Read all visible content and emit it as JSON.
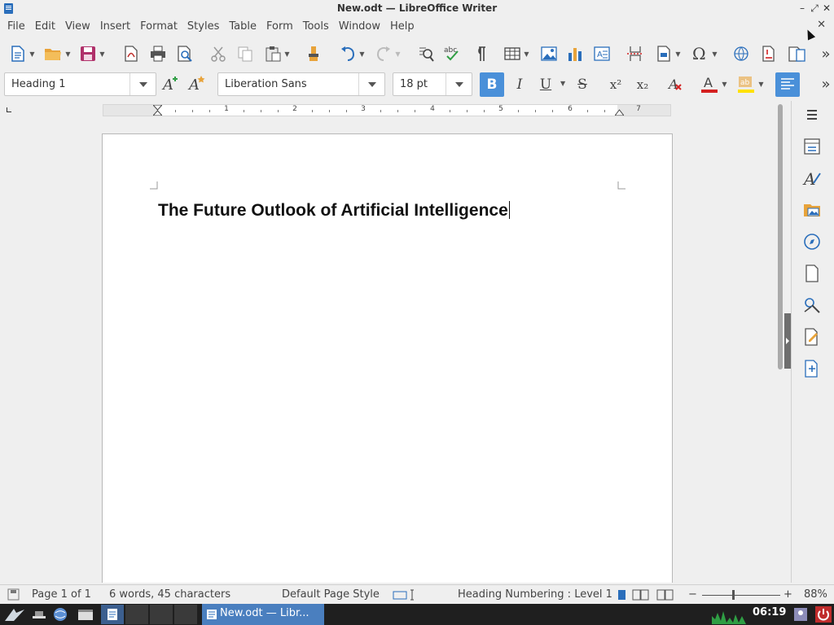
{
  "window": {
    "title": "New.odt — LibreOffice Writer",
    "minimize_glyph": "–",
    "restore_glyph": "⤢",
    "close_glyph": "✕"
  },
  "menu": {
    "items": [
      "File",
      "Edit",
      "View",
      "Insert",
      "Format",
      "Styles",
      "Table",
      "Form",
      "Tools",
      "Window",
      "Help"
    ],
    "close_document_glyph": "✕"
  },
  "standard_toolbar": {
    "icons": [
      "new-document-icon",
      "open-icon",
      "save-icon",
      "export-pdf-icon",
      "print-icon",
      "print-preview-icon",
      "cut-icon",
      "copy-icon",
      "paste-icon",
      "clone-formatting-icon",
      "undo-icon",
      "redo-icon",
      "find-replace-icon",
      "spelling-icon",
      "formatting-marks-icon",
      "insert-table-icon",
      "insert-image-icon",
      "insert-chart-icon",
      "insert-textbox-icon",
      "page-break-icon",
      "insert-field-icon",
      "special-character-icon",
      "hyperlink-icon",
      "footnote-icon",
      "comment-icon",
      "overflow-chevron-icon"
    ],
    "overflow_glyph": "»"
  },
  "formatting_toolbar": {
    "paragraph_style": "Heading 1",
    "font_name": "Liberation Sans",
    "font_size": "18 pt",
    "bold_label": "B",
    "italic_label": "I",
    "underline_label": "U",
    "strike_label": "S",
    "superscript_label": "x²",
    "subscript_label": "x₂",
    "bold_active": true,
    "align_left_active": true,
    "overflow_glyph": "»",
    "font_color": "#d42020",
    "highlight_color": "#ffe100",
    "active_color": "#4a90d9"
  },
  "ruler": {
    "numbers": [
      "1",
      "2",
      "3",
      "4",
      "5",
      "6",
      "7"
    ]
  },
  "document": {
    "heading": "The Future Outlook of Artificial Intelligence"
  },
  "sidebar": {
    "icons": [
      "menu-icon",
      "properties-icon",
      "styles-icon",
      "gallery-icon",
      "navigator-icon",
      "page-icon",
      "style-inspector-icon",
      "manage-changes-icon",
      "design-icon"
    ]
  },
  "status_bar": {
    "page": "Page 1 of 1",
    "word_count": "6 words, 45 characters",
    "page_style": "Default Page Style",
    "outline": "Heading Numbering : Level 1",
    "zoom": "88%",
    "zoom_minus": "−",
    "zoom_plus": "+"
  },
  "taskbar": {
    "active_window": "New.odt — Libr...",
    "clock": "06:19"
  }
}
